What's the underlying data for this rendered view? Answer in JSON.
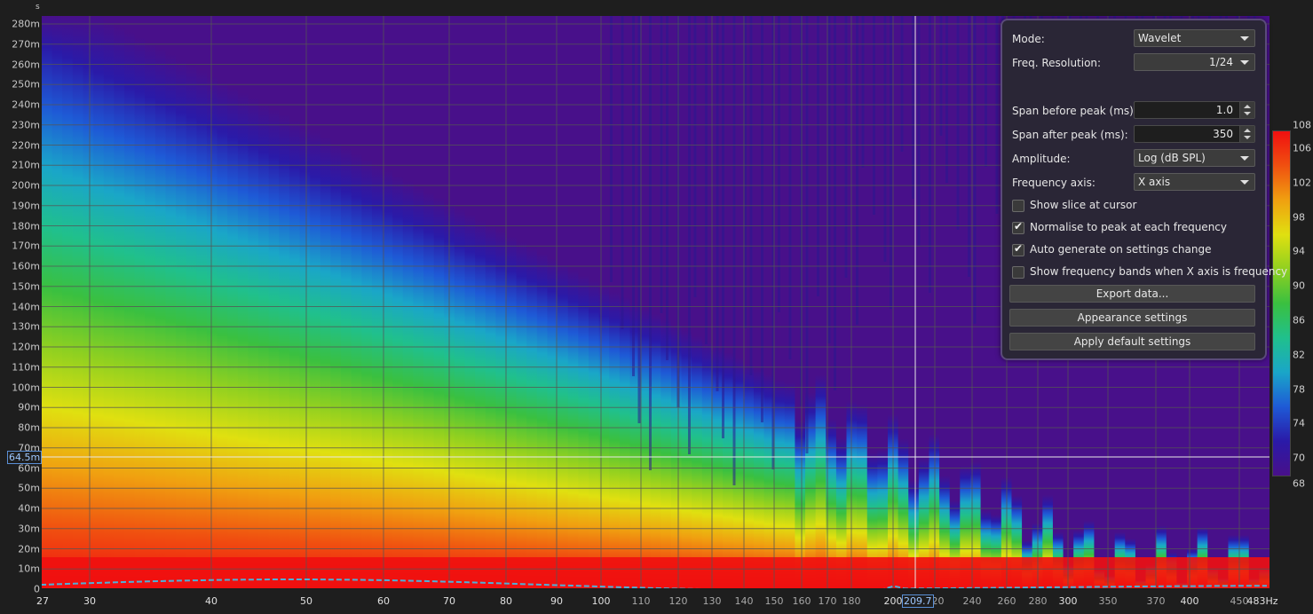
{
  "y_axis": {
    "unit": "s",
    "ticks": [
      "280m",
      "270m",
      "260m",
      "250m",
      "240m",
      "230m",
      "220m",
      "210m",
      "200m",
      "190m",
      "180m",
      "170m",
      "160m",
      "150m",
      "140m",
      "130m",
      "120m",
      "110m",
      "100m",
      "90m",
      "80m",
      "70m",
      "60m",
      "50m",
      "40m",
      "30m",
      "20m",
      "10m",
      "0"
    ]
  },
  "x_axis": {
    "ticks": [
      {
        "label": "27",
        "major": true
      },
      {
        "label": "30",
        "major": true
      },
      {
        "label": "40",
        "major": true
      },
      {
        "label": "50",
        "major": true
      },
      {
        "label": "60",
        "major": true
      },
      {
        "label": "70",
        "major": true
      },
      {
        "label": "80",
        "major": true
      },
      {
        "label": "90",
        "major": true
      },
      {
        "label": "100",
        "major": true
      },
      {
        "label": "110",
        "major": false
      },
      {
        "label": "120",
        "major": false
      },
      {
        "label": "130",
        "major": false
      },
      {
        "label": "140",
        "major": false
      },
      {
        "label": "150",
        "major": false
      },
      {
        "label": "160",
        "major": false
      },
      {
        "label": "170",
        "major": false
      },
      {
        "label": "180",
        "major": false
      },
      {
        "label": "200",
        "major": true
      },
      {
        "label": "220",
        "major": false
      },
      {
        "label": "240",
        "major": false
      },
      {
        "label": "260",
        "major": false
      },
      {
        "label": "280",
        "major": false
      },
      {
        "label": "300",
        "major": true
      },
      {
        "label": "350",
        "major": false
      },
      {
        "label": "370",
        "major": false
      },
      {
        "label": "400",
        "major": true
      },
      {
        "label": "450",
        "major": false
      },
      {
        "label": "483Hz",
        "major": true
      }
    ]
  },
  "cursor": {
    "time_label": "64.5m",
    "freq_label": "209.7"
  },
  "colorbar": {
    "max": "108",
    "min": "68",
    "ticks": [
      "106",
      "102",
      "98",
      "94",
      "90",
      "86",
      "82",
      "78",
      "74",
      "70"
    ]
  },
  "panel": {
    "mode": {
      "label": "Mode:",
      "value": "Wavelet"
    },
    "freq_resolution": {
      "label": "Freq. Resolution:",
      "value": "1/24"
    },
    "span_before": {
      "label": "Span before peak (ms):",
      "value": "1.0"
    },
    "span_after": {
      "label": "Span after peak (ms):",
      "value": "350"
    },
    "amplitude": {
      "label": "Amplitude:",
      "value": "Log (dB SPL)"
    },
    "frequency_axis": {
      "label": "Frequency axis:",
      "value": "X axis"
    },
    "show_slice": {
      "label": "Show slice at cursor",
      "checked": false
    },
    "normalise": {
      "label": "Normalise to peak at each frequency",
      "checked": true
    },
    "auto_generate": {
      "label": "Auto generate on settings change",
      "checked": true
    },
    "show_bands": {
      "label": "Show frequency bands when X axis is frequency",
      "checked": false
    },
    "export_button": "Export data...",
    "appearance_button": "Appearance settings",
    "default_button": "Apply default settings"
  },
  "colors": {
    "panel_bg": "#2a2636",
    "panel_border": "#5a4a7a",
    "cursor_label": "#9ec8ff",
    "peak_line": "#4fb0d8"
  }
}
